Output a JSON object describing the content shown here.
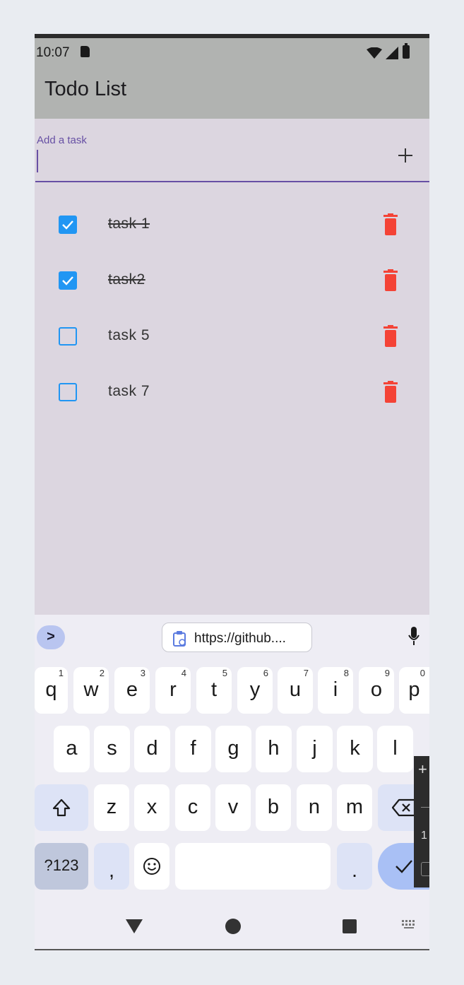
{
  "status": {
    "time": "10:07"
  },
  "app": {
    "title": "Todo List"
  },
  "input": {
    "label": "Add a task",
    "value": ""
  },
  "tasks": [
    {
      "label": "task 1",
      "done": true
    },
    {
      "label": "task2",
      "done": true
    },
    {
      "label": "task 5",
      "done": false
    },
    {
      "label": "task 7",
      "done": false
    }
  ],
  "colors": {
    "accent": "#6750a4",
    "checkbox": "#2196f3",
    "delete": "#f44336",
    "appbar": "#b1b3b1",
    "background": "#dcd6e0"
  },
  "keyboard": {
    "expand_label": ">",
    "clipboard_text": "https://github....",
    "row1": [
      {
        "label": "q",
        "hint": "1"
      },
      {
        "label": "w",
        "hint": "2"
      },
      {
        "label": "e",
        "hint": "3"
      },
      {
        "label": "r",
        "hint": "4"
      },
      {
        "label": "t",
        "hint": "5"
      },
      {
        "label": "y",
        "hint": "6"
      },
      {
        "label": "u",
        "hint": "7"
      },
      {
        "label": "i",
        "hint": "8"
      },
      {
        "label": "o",
        "hint": "9"
      },
      {
        "label": "p",
        "hint": "0"
      }
    ],
    "row2": [
      "a",
      "s",
      "d",
      "f",
      "g",
      "h",
      "j",
      "k",
      "l"
    ],
    "row3": [
      "z",
      "x",
      "c",
      "v",
      "b",
      "n",
      "m"
    ],
    "symbols_label": "?123",
    "comma_label": ",",
    "period_label": ".",
    "emoji_label": "☺"
  },
  "side_panel": {
    "text": "1"
  },
  "icons": [
    "sd-card-icon",
    "wifi-icon",
    "cellular-icon",
    "battery-icon",
    "plus-icon",
    "delete-icon",
    "clipboard-icon",
    "mic-icon",
    "shift-icon",
    "backspace-icon",
    "checkmark-icon",
    "emoji-icon",
    "back-icon",
    "home-icon",
    "recents-icon",
    "keyboard-icon"
  ]
}
